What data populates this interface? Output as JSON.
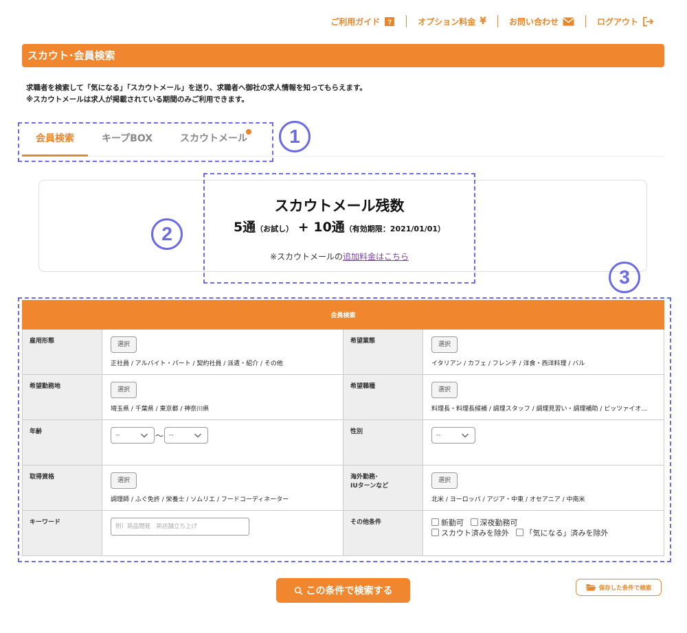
{
  "colors": {
    "accent": "#f0862e",
    "annotation": "#6a6ae6",
    "link": "#7b3fa8"
  },
  "topnav": {
    "guide": "ご利用ガイド",
    "options": "オプション料金",
    "contact": "お問い合わせ",
    "logout": "ログアウト"
  },
  "header": {
    "title": "スカウト･会員検索"
  },
  "intro": {
    "line1": "求職者を検索して「気になる」「スカウトメール」を送り、求職者へ御社の求人情報を知ってもらえます。",
    "line2": "※スカウトメールは求人が掲載されている期間のみご利用できます。"
  },
  "tabs": [
    {
      "label": "会員検索",
      "active": true
    },
    {
      "label": "キープBOX",
      "active": false
    },
    {
      "label": "スカウトメール",
      "active": false,
      "badge": true
    }
  ],
  "annotations": {
    "n1": "1",
    "n2": "2",
    "n3": "3"
  },
  "scout_mail": {
    "title": "スカウトメール残数",
    "trial_count": "5通",
    "trial_label": "（お試し）",
    "plus": "+",
    "paid_count": "10通",
    "expiry": "（有効期限：2021/01/01）",
    "note_prefix": "※スカウトメールの",
    "note_link": "追加料金はこちら"
  },
  "search": {
    "title": "会員検索",
    "select_label": "選択",
    "employment": {
      "label": "雇用形態",
      "value": "正社員 / アルバイト・パート / 契約社員 / 派遣・紹介 / その他"
    },
    "industry": {
      "label": "希望業態",
      "value": "イタリアン / カフェ / フレンチ / 洋食・西洋料理 / バル"
    },
    "location": {
      "label": "希望勤務地",
      "value": "埼玉県 / 千葉県 / 東京都 / 神奈川県"
    },
    "occupation": {
      "label": "希望職種",
      "value": "料理長・料理長候補 / 調理スタッフ / 調理見習い・調理補助 / ピッツァイオ…"
    },
    "age": {
      "label": "年齢",
      "from": "--",
      "tilde": "〜",
      "to": "--"
    },
    "gender": {
      "label": "性別",
      "value": "--"
    },
    "qualification": {
      "label": "取得資格",
      "value": "調理師 / ふぐ免許 / 栄養士 / ソムリエ / フードコーディネーター"
    },
    "overseas": {
      "label_line1": "海外勤務･",
      "label_line2": "IUターンなど",
      "value": "北米 / ヨーロッパ / アジア・中東 / オセアニア / 中南米"
    },
    "keyword": {
      "label": "キーワード",
      "placeholder": "例）商品開発　新店舗立ち上げ"
    },
    "other": {
      "label": "その他条件",
      "options": [
        "新勤可",
        "深夜勤務可",
        "スカウト済みを除外",
        "「気になる」済みを除外"
      ]
    }
  },
  "buttons": {
    "search": "この条件で検索する",
    "saved": "保存した条件で検索"
  }
}
